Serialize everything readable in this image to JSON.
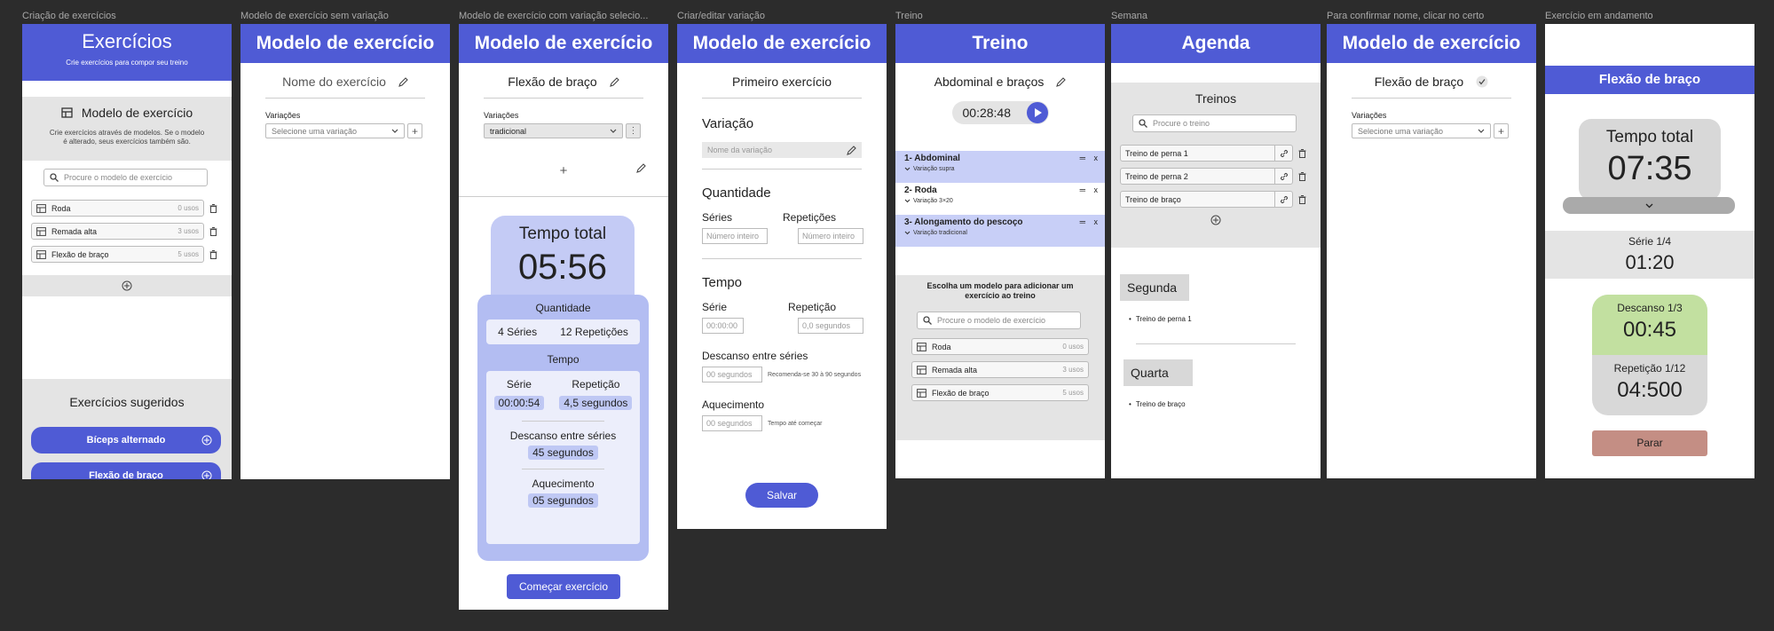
{
  "frames": {
    "f1": {
      "label": "Criação de exercícios",
      "title": "Exercícios",
      "subtitle": "Crie exercícios para compor seu treino",
      "section": "Modelo de exercício",
      "desc": "Crie exercícios através de modelos. Se o modelo é alterado, seus exercícios também são.",
      "search_ph": "Procure o modelo de exercício",
      "items": [
        {
          "name": "Roda",
          "uses": "0 usos"
        },
        {
          "name": "Remada alta",
          "uses": "3 usos"
        },
        {
          "name": "Flexão de braço",
          "uses": "5 usos"
        }
      ],
      "suggested_title": "Exercícios sugeridos",
      "suggested": [
        "Bíceps alternado",
        "Flexão de braço"
      ]
    },
    "f2": {
      "label": "Modelo de exercício sem variação",
      "title": "Modelo de exercício",
      "name_ph": "Nome do exercício",
      "variations": "Variações",
      "select_ph": "Selecione uma variação"
    },
    "f3": {
      "label": "Modelo de exercício com variação selecio...",
      "title": "Modelo de exercício",
      "name": "Flexão de braço",
      "variations": "Variações",
      "selected": "tradicional",
      "total_label": "Tempo total",
      "total": "05:56",
      "qty_label": "Quantidade",
      "series": "4 Séries",
      "reps": "12 Repetições",
      "time_label": "Tempo",
      "serie_label": "Série",
      "serie_val": "00:00:54",
      "rep_label": "Repetição",
      "rep_val": "4,5 segundos",
      "rest_label": "Descanso entre séries",
      "rest_val": "45 segundos",
      "warm_label": "Aquecimento",
      "warm_val": "05 segundos",
      "start": "Começar exercício"
    },
    "f4": {
      "label": "Criar/editar variação",
      "title": "Modelo de exercício",
      "name": "Primeiro exercício",
      "variation": "Variação",
      "var_ph": "Nome da variação",
      "qty": "Quantidade",
      "series": "Séries",
      "reps": "Repetições",
      "int_ph": "Número inteiro",
      "time": "Tempo",
      "serie": "Série",
      "serie_ph": "00:00:00",
      "rep": "Repetição",
      "rep_ph": "0,0 segundos",
      "rest": "Descanso entre séries",
      "rest_ph": "00 segundos",
      "rest_hint": "Recomenda-se 30 à 90 segundos",
      "warm": "Aquecimento",
      "warm_ph": "00 segundos",
      "warm_hint": "Tempo até começar",
      "save": "Salvar"
    },
    "f5": {
      "label": "Treino",
      "title": "Treino",
      "name": "Abdominal e braços",
      "timer": "00:28:48",
      "exercises": [
        {
          "name": "1- Abdominal",
          "var": "Variação supra"
        },
        {
          "name": "2- Roda",
          "var": "Variação 3×20"
        },
        {
          "name": "3- Alongamento do pescoço",
          "var": "Variação tradicional"
        }
      ],
      "choose": "Escolha um modelo para adicionar um exercício ao treino",
      "search_ph": "Procure o modelo de exercício",
      "items": [
        {
          "name": "Roda",
          "uses": "0 usos"
        },
        {
          "name": "Remada alta",
          "uses": "3 usos"
        },
        {
          "name": "Flexão de braço",
          "uses": "5 usos"
        }
      ]
    },
    "f6": {
      "label": "Semana",
      "title": "Agenda",
      "section": "Treinos",
      "search_ph": "Procure o treino",
      "items": [
        "Treino de perna 1",
        "Treino de perna 2",
        "Treino de braço"
      ],
      "days": [
        {
          "day": "Segunda",
          "entry": "Treino de perna 1"
        },
        {
          "day": "Quarta",
          "entry": "Treino de braço"
        }
      ]
    },
    "f7": {
      "label": "Para confirmar nome, clicar no certo",
      "title": "Modelo de exercício",
      "name": "Flexão de braço",
      "variations": "Variações",
      "select_ph": "Selecione uma variação"
    },
    "f8": {
      "label": "Exercício em andamento",
      "title": "Flexão de braço",
      "total_label": "Tempo total",
      "total": "07:35",
      "serie_label": "Série 1/4",
      "serie_val": "01:20",
      "rest_label": "Descanso 1/3",
      "rest_val": "00:45",
      "rep_label": "Repetição 1/12",
      "rep_val": "04:500",
      "stop": "Parar"
    }
  },
  "colors": {
    "accent": "#4f5bd5",
    "light_accent": "#bfc8f4",
    "panel_gray": "#e4e4e4",
    "green": "#c2e0a0",
    "stop": "#c48e84",
    "canvas": "#2c2c2c"
  },
  "icons": [
    "layout-icon",
    "search-icon",
    "trash-icon",
    "plus-circle-icon",
    "pencil-icon",
    "chevron-down-icon",
    "plus-icon",
    "kebab-icon",
    "play-icon",
    "link-icon",
    "check-icon",
    "minus-icon",
    "close-icon"
  ]
}
